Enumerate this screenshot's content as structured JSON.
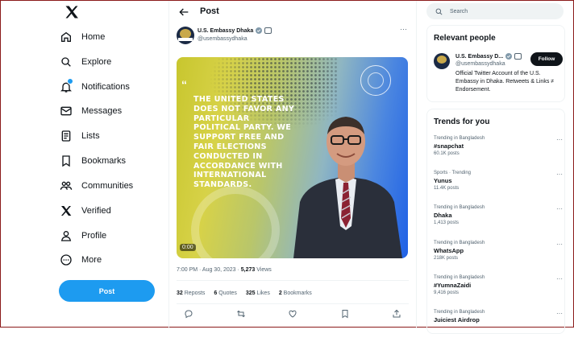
{
  "nav": {
    "items": [
      {
        "label": "Home",
        "icon": "home-icon"
      },
      {
        "label": "Explore",
        "icon": "search-icon"
      },
      {
        "label": "Notifications",
        "icon": "bell-icon"
      },
      {
        "label": "Messages",
        "icon": "envelope-icon"
      },
      {
        "label": "Lists",
        "icon": "list-icon"
      },
      {
        "label": "Bookmarks",
        "icon": "bookmark-icon"
      },
      {
        "label": "Communities",
        "icon": "people-icon"
      },
      {
        "label": "Verified",
        "icon": "x-logo-icon"
      },
      {
        "label": "Profile",
        "icon": "person-icon"
      },
      {
        "label": "More",
        "icon": "more-circle-icon"
      }
    ],
    "post_button": "Post"
  },
  "main": {
    "title": "Post",
    "author": {
      "name": "U.S. Embassy Dhaka",
      "handle": "@usembassydhaka"
    },
    "media": {
      "quote": "THE UNITED STATES DOES NOT FAVOR ANY PARTICULAR POLITICAL PARTY. WE SUPPORT FREE AND FAIR ELECTIONS CONDUCTED IN ACCORDANCE WITH INTERNATIONAL STANDARDS.",
      "duration": "0:00"
    },
    "time": "7:00 PM · Aug 30, 2023 · ",
    "views_count": "5,273",
    "views_label": " Views",
    "stats": [
      {
        "count": "32",
        "label": " Reposts"
      },
      {
        "count": "6",
        "label": " Quotes"
      },
      {
        "count": "325",
        "label": " Likes"
      },
      {
        "count": "2",
        "label": " Bookmarks"
      }
    ]
  },
  "right": {
    "search_placeholder": "Search",
    "relevant": {
      "title": "Relevant people",
      "name": "U.S. Embassy D...",
      "handle": "@usembassydhaka",
      "follow": "Follow",
      "bio": "Official Twitter Account of the U.S. Embassy in Dhaka. Retweets & Links ≠ Endorsement."
    },
    "trends_title": "Trends for you",
    "trends": [
      {
        "context": "Trending in Bangladesh",
        "name": "#snapchat",
        "count": "60.1K posts"
      },
      {
        "context": "Sports · Trending",
        "name": "Yunus",
        "count": "11.4K posts"
      },
      {
        "context": "Trending in Bangladesh",
        "name": "Dhaka",
        "count": "1,413 posts"
      },
      {
        "context": "Trending in Bangladesh",
        "name": "WhatsApp",
        "count": "218K posts"
      },
      {
        "context": "Trending in Bangladesh",
        "name": "#YumnaZaidi",
        "count": "9,416 posts"
      },
      {
        "context": "Trending in Bangladesh",
        "name": "Juiciest Airdrop",
        "count": ""
      }
    ]
  },
  "colors": {
    "accent": "#1d9bf0",
    "text": "#0f1419",
    "muted": "#536471"
  }
}
